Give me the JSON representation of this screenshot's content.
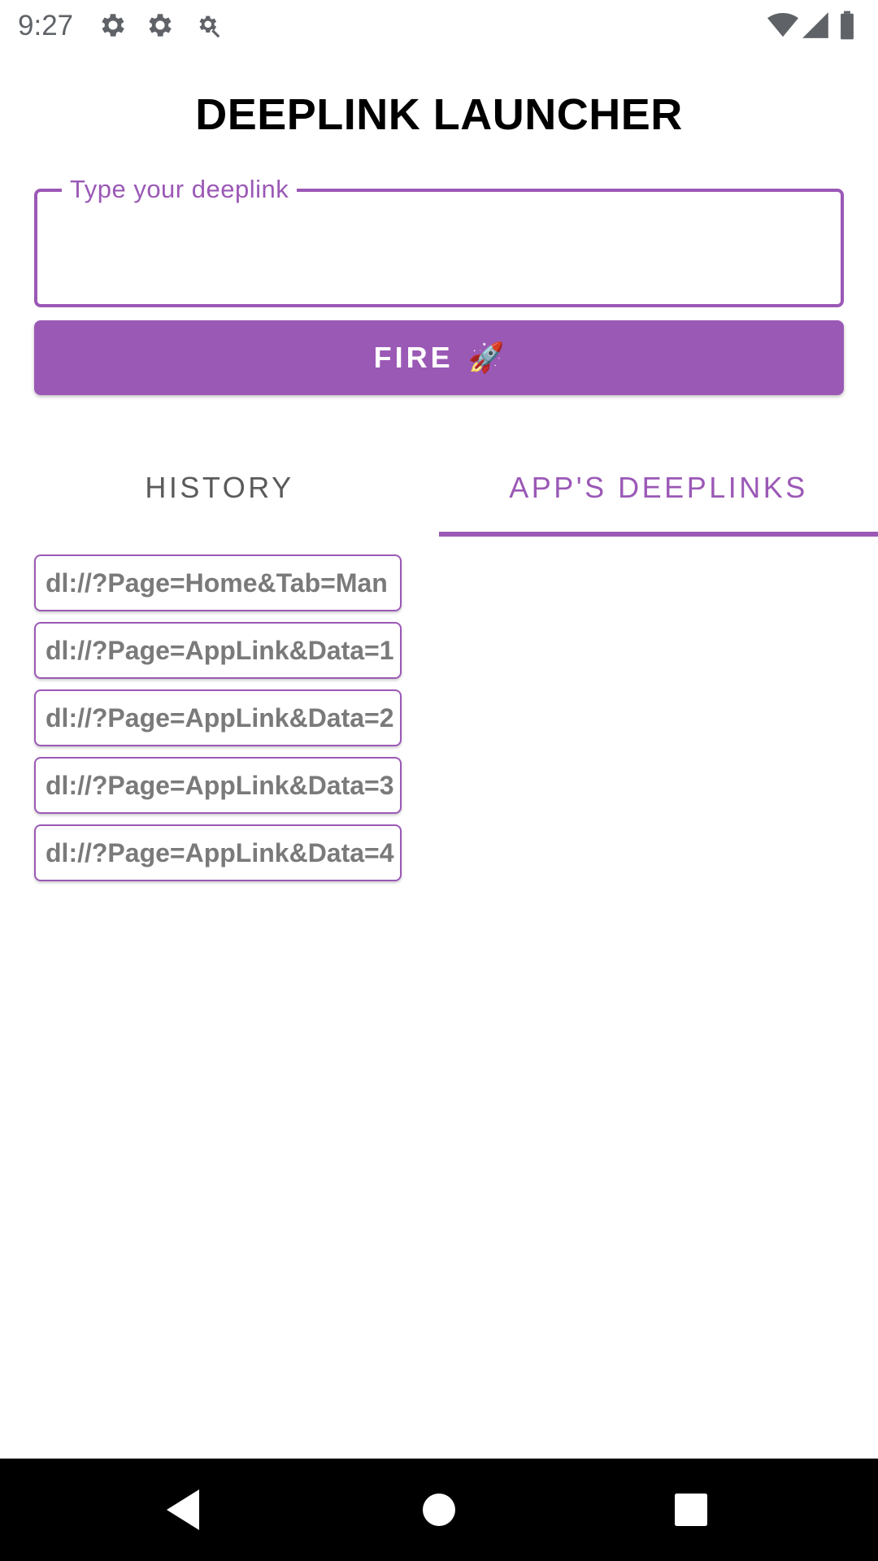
{
  "status_bar": {
    "time": "9:27",
    "icons": [
      "settings-gear-icon",
      "settings-gear-icon",
      "settings-search-icon",
      "wifi-icon",
      "signal-icon",
      "battery-icon"
    ]
  },
  "title": "DEEPLINK LAUNCHER",
  "deeplink_input": {
    "label": "Type your deeplink",
    "value": ""
  },
  "fire_button": {
    "label": "FIRE",
    "icon": "🚀"
  },
  "tabs": [
    {
      "label": "HISTORY",
      "selected": false
    },
    {
      "label": "APP'S DEEPLINKS",
      "selected": true
    }
  ],
  "deeplinks": [
    "dl://?Page=Home&Tab=Man",
    "dl://?Page=AppLink&Data=1",
    "dl://?Page=AppLink&Data=2",
    "dl://?Page=AppLink&Data=3",
    "dl://?Page=AppLink&Data=4"
  ],
  "nav_bar": {
    "buttons": [
      "back-icon",
      "home-icon",
      "recents-icon"
    ]
  },
  "colors": {
    "accent": "#9b59b6",
    "chip_text": "#7a7a7a",
    "inactive_tab": "#5a5a5a",
    "nav_bar": "#000000"
  }
}
